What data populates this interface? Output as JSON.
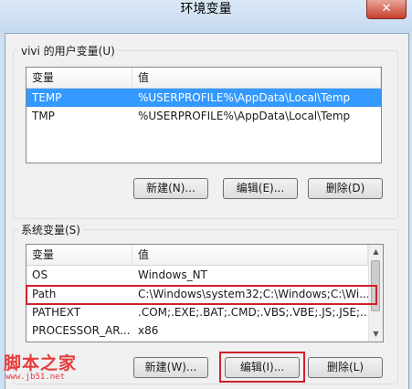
{
  "window": {
    "title": "环境变量",
    "close_glyph": "✕"
  },
  "user_vars": {
    "group_label": "vivi 的用户变量(U)",
    "columns": [
      "变量",
      "值"
    ],
    "rows": [
      {
        "name": "TEMP",
        "value": "%USERPROFILE%\\AppData\\Local\\Temp",
        "selected": true
      },
      {
        "name": "TMP",
        "value": "%USERPROFILE%\\AppData\\Local\\Temp",
        "selected": false
      }
    ],
    "buttons": {
      "new": "新建(N)...",
      "edit": "编辑(E)...",
      "delete": "删除(D)"
    }
  },
  "system_vars": {
    "group_label": "系统变量(S)",
    "columns": [
      "变量",
      "值"
    ],
    "rows": [
      {
        "name": "OS",
        "value": "Windows_NT"
      },
      {
        "name": "Path",
        "value": "C:\\Windows\\system32;C:\\Windows;C:\\Wi..."
      },
      {
        "name": "PATHEXT",
        "value": ".COM;.EXE;.BAT;.CMD;.VBS;.VBE;.JS;.JSE;..."
      },
      {
        "name": "PROCESSOR_AR...",
        "value": "x86"
      }
    ],
    "buttons": {
      "new": "新建(W)...",
      "edit": "编辑(I)...",
      "delete": "删除(L)"
    }
  },
  "watermark": {
    "text": "脚本之家",
    "url": "www.jb51.net"
  },
  "colors": {
    "selection": "#3399ff",
    "highlight": "#d0202a"
  }
}
